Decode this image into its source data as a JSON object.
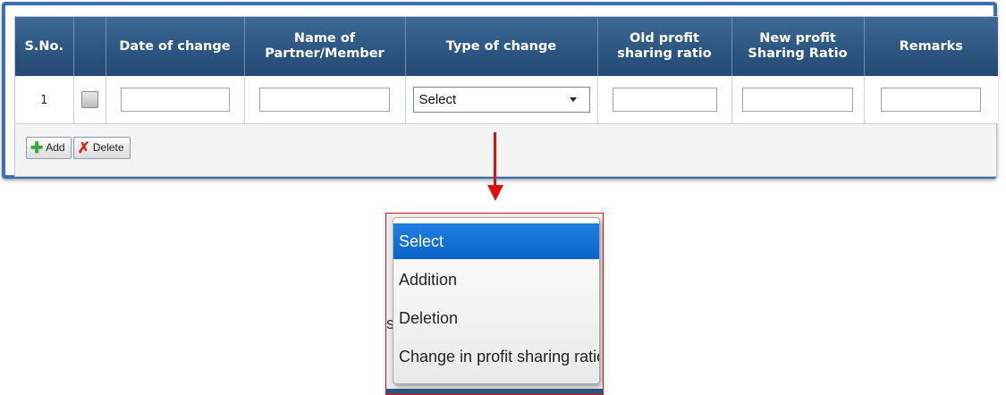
{
  "table": {
    "headers": [
      "S.No.",
      "",
      "Date of change",
      "Name of\nPartner/Member",
      "Type of change",
      "Old profit\nsharing ratio",
      "New profit\nSharing Ratio",
      "Remarks"
    ],
    "row": {
      "sno": "1",
      "type_select_value": "Select"
    }
  },
  "buttons": {
    "add_label": "Add",
    "delete_label": "Delete"
  },
  "dropdown": {
    "options": [
      "Select",
      "Addition",
      "Deletion",
      "Change in profit sharing ratio"
    ],
    "selected_index": 0,
    "partial_bg_text": "s"
  },
  "colors": {
    "frame": "#3a6fb3",
    "header": "#2d5682",
    "arrow": "#e01010",
    "selected_option": "#0b64c8"
  },
  "icons": [
    "plus-icon",
    "delete-x-icon",
    "chevron-down-icon",
    "arrow-down-icon"
  ]
}
